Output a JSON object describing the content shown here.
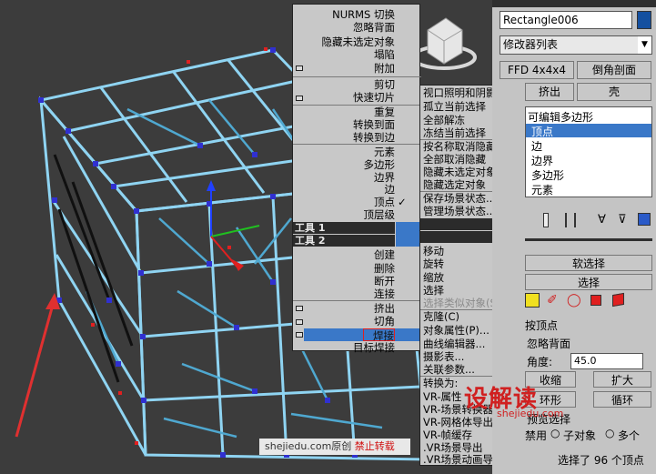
{
  "menu_left": {
    "items_top": [
      "NURMS 切换",
      "忽略背面",
      "隐藏未选定对象",
      "塌陷",
      "附加"
    ],
    "items_mid": [
      "剪切",
      "快速切片",
      "重复",
      "转换到面",
      "转换到边"
    ],
    "items_sub": [
      "元素",
      "多边形",
      "边界",
      "边",
      "顶点",
      "顶层级"
    ],
    "tools1": "工具 1",
    "tools2": "工具 2",
    "items_bottom": [
      "创建",
      "删除",
      "断开",
      "连接",
      "挤出",
      "切角",
      "焊接",
      "目标焊接"
    ]
  },
  "menu_right": {
    "items_top": [
      "视口照明和阴影",
      "孤立当前选择",
      "全部解冻",
      "冻结当前选择",
      "按名称取消隐藏",
      "全部取消隐藏",
      "隐藏未选定对象",
      "隐藏选定对象",
      "保存场景状态...",
      "管理场景状态..."
    ],
    "display_label": "显示",
    "transform_label": "变换",
    "items_bottom": [
      "移动",
      "旋转",
      "缩放",
      "选择",
      "选择类似对象(S)",
      "克隆(C)",
      "对象属性(P)...",
      "曲线编辑器...",
      "摄影表...",
      "关联参数...",
      "转换为:",
      "VR-属性",
      "VR-场景转换器",
      "VR-网格体导出",
      "VR-帧缓存",
      ".VR场景导出",
      ".VR场景动画导出"
    ]
  },
  "panel": {
    "object_name": "Rectangle006",
    "object_color": "#1450a0",
    "modifier_list": "修改器列表",
    "btn_ffd": "FFD 4x4x4",
    "btn_chamfer": "倒角剖面",
    "btn_extrude": "挤出",
    "btn_shell": "壳",
    "stack_title": "可编辑多边形",
    "stack_items": [
      "顶点",
      "边",
      "边界",
      "多边形",
      "元素"
    ],
    "soft_selection": "软选择",
    "selection": "选择",
    "by_vertex": "按顶点",
    "ignore_backface": "忽略背面",
    "angle_label": "角度:",
    "angle_value": "45.0",
    "shrink": "收缩",
    "grow": "扩大",
    "ring": "环形",
    "loop": "循环",
    "preview_label": "预览选择",
    "disabled_label": "禁用",
    "subobject": "子对象",
    "multi": "多个",
    "status": "选择了 96 个顶点"
  },
  "footer": {
    "site": "shejiedu.com原创",
    "warning": "禁止转载"
  },
  "watermark": {
    "logo": "设解读",
    "url": "shejiedu.com"
  },
  "colors": {
    "highlight": "#3a78c8",
    "menu_bg": "#c8c8c8",
    "wire": "#7ec8ec",
    "vertex_blue": "#3030d0",
    "vertex_red": "#e02020",
    "arrow": "#e03030"
  }
}
